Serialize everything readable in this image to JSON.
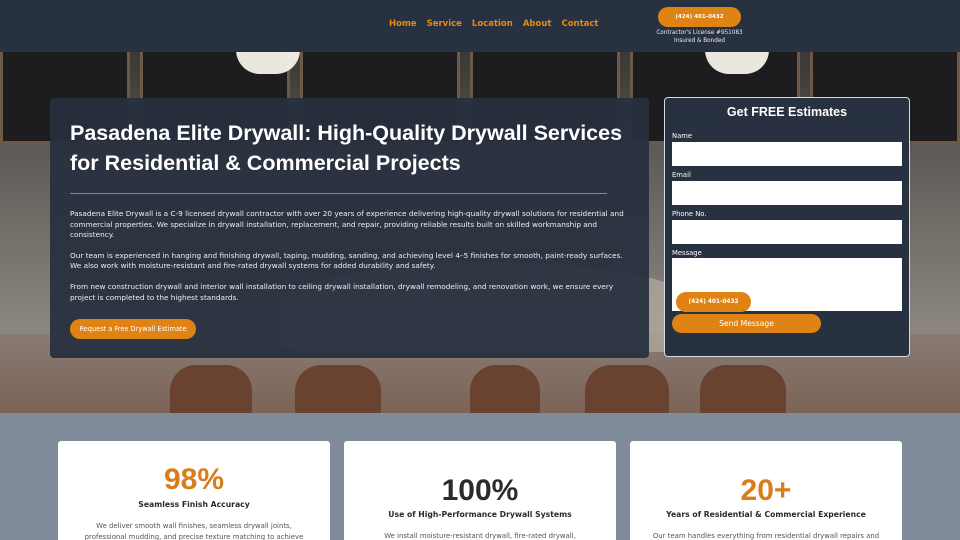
{
  "nav": {
    "items": [
      "Home",
      "Service",
      "Location",
      "About",
      "Contact"
    ],
    "phone_label": "(424) 401-0432",
    "license_line1": "Contractor's License #951083",
    "license_line2": "Insured & Bonded"
  },
  "hero": {
    "title": "Pasadena Elite Drywall: High-Quality Drywall Services for Residential & Commercial Projects",
    "paragraphs": [
      "Pasadena Elite Drywall is a C-9 licensed drywall contractor with over 20 years of experience delivering high-quality drywall solutions for residential and commercial properties. We specialize in drywall installation, replacement, and repair, providing reliable results built on skilled workmanship and consistency.",
      "Our team is experienced in hanging and finishing drywall, taping, mudding, sanding, and achieving level 4–5 finishes for smooth, paint-ready surfaces. We also work with moisture-resistant and fire-rated drywall systems for added durability and safety.",
      "From new construction drywall and interior wall installation to ceiling drywall installation, drywall remodeling, and renovation work, we ensure every project is completed to the highest standards."
    ],
    "cta_label": "Request a Free Drywall Estimate"
  },
  "form": {
    "title": "Get FREE Estimates",
    "name_label": "Name",
    "email_label": "Email",
    "phone_label": "Phone No.",
    "message_label": "Message",
    "phone_button": "(424) 401-0432",
    "submit_label": "Send Message"
  },
  "stats": [
    {
      "value": "98%",
      "caption": "Seamless Finish Accuracy",
      "description": "We deliver smooth wall finishes, seamless drywall joints, professional mudding, and precise texture matching to achieve clean, high-end, paint-",
      "color": "#d97d1a"
    },
    {
      "value": "100%",
      "caption": "Use of High-Performance Drywall Systems",
      "description": "We install moisture-resistant drywall, fire-rated drywall, soundproof drywall,",
      "color": "#2b2b2b"
    },
    {
      "value": "20+",
      "caption": "Years of Residential & Commercial Experience",
      "description": "Our team handles everything from residential drywall repairs and ceiling",
      "color": "#d97d1a"
    }
  ]
}
